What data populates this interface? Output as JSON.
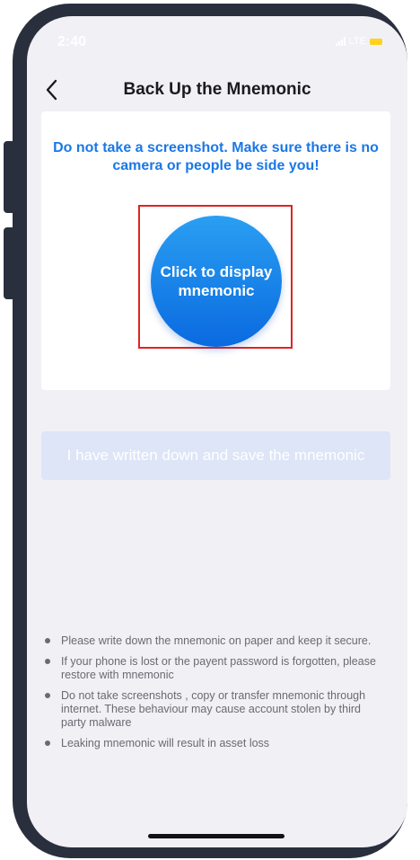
{
  "status_bar": {
    "time": "2:40",
    "network": "LTE",
    "icons": [
      "signal-icon",
      "battery-icon"
    ],
    "battery_color": "#ffd21e"
  },
  "nav": {
    "title": "Back Up the Mnemonic",
    "back_icon": "chevron-left-icon"
  },
  "card": {
    "warning": "Do not take a screenshot. Make sure there is no camera or people be side you!",
    "display_button_label": "Click to display mnemonic",
    "highlight_color": "#e02424"
  },
  "confirm_button_label": "I have written down and save the mnemonic",
  "tips": [
    "Please write down the mnemonic on paper and keep it secure.",
    "If your phone is lost or the payent password is forgotten, please restore with mnemonic",
    "Do not take screenshots , copy or transfer mnemonic through internet. These behaviour may cause account stolen by third party malware",
    "Leaking mnemonic will result in asset loss"
  ],
  "colors": {
    "accent": "#1a78e6",
    "button_gradient_top": "#2a9ff2",
    "button_gradient_bottom": "#0a6ae0",
    "disabled_button": "#dde5f7",
    "background": "#f1f0f5"
  }
}
